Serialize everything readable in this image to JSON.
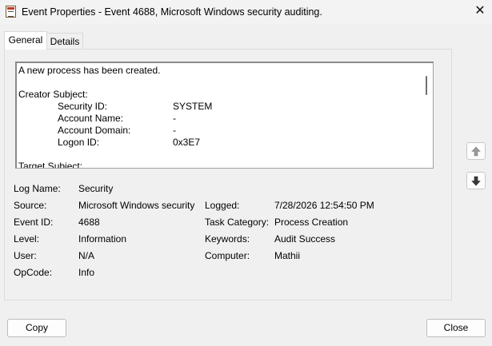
{
  "window": {
    "title": "Event Properties - Event 4688, Microsoft Windows security auditing.",
    "close_glyph": "✕"
  },
  "tabs": [
    {
      "label": "General",
      "selected": true
    },
    {
      "label": "Details",
      "selected": false
    }
  ],
  "description": {
    "line1": "A new process has been created.",
    "section1": "Creator Subject:",
    "rows": [
      {
        "key": "Security ID:",
        "value": "SYSTEM"
      },
      {
        "key": "Account Name:",
        "value": "-"
      },
      {
        "key": "Account Domain:",
        "value": "-"
      },
      {
        "key": "Logon ID:",
        "value": "0x3E7"
      }
    ],
    "section2": "Target Subject:"
  },
  "fields": {
    "log_name": {
      "label": "Log Name:",
      "value": "Security"
    },
    "source": {
      "label": "Source:",
      "value": "Microsoft Windows security"
    },
    "logged": {
      "label": "Logged:",
      "value": "7/28/2026 12:54:50 PM"
    },
    "event_id": {
      "label": "Event ID:",
      "value": "4688"
    },
    "task_category": {
      "label": "Task Category:",
      "value": "Process Creation"
    },
    "level": {
      "label": "Level:",
      "value": "Information"
    },
    "keywords": {
      "label": "Keywords:",
      "value": "Audit Success"
    },
    "user": {
      "label": "User:",
      "value": "N/A"
    },
    "computer": {
      "label": "Computer:",
      "value": "Mathii"
    },
    "opcode": {
      "label": "OpCode:",
      "value": "Info"
    }
  },
  "buttons": {
    "copy": "Copy",
    "close": "Close",
    "previous_icon": "arrow-up-icon",
    "next_icon": "arrow-down-icon"
  }
}
